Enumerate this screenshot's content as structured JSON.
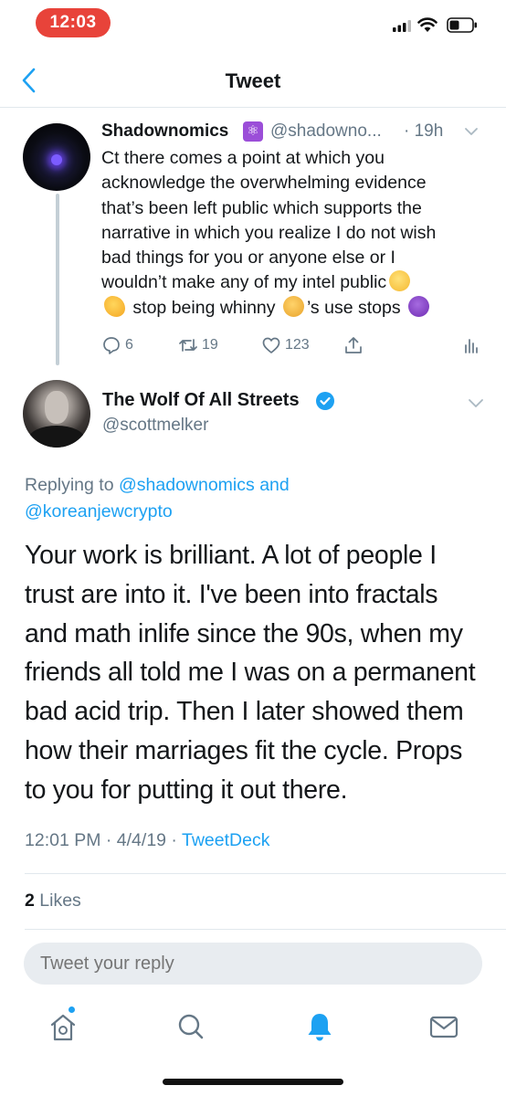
{
  "status_bar": {
    "time": "12:03"
  },
  "nav": {
    "title": "Tweet"
  },
  "parent_tweet": {
    "name": "Shadownomics",
    "handle": "@shadowno...",
    "time": "· 19h",
    "lines": [
      "Ct there comes a point at which you",
      "acknowledge the overwhelming evidence",
      "that’s been left public which supports the",
      "narrative in which you realize I do not wish",
      "bad things for you or anyone else or I",
      "wouldn’t make any of my intel public"
    ],
    "line7_a": "stop being whinny",
    "line7_b": "’s use stops",
    "actions": {
      "replies": "6",
      "retweets": "19",
      "likes": "123"
    },
    "colors": {
      "badge": "#9b4ed8"
    }
  },
  "main_tweet": {
    "name": "The Wolf Of All Streets",
    "handle": "@scottmelker",
    "replying_prefix": "Replying to",
    "replying_user1": "@shadownomics",
    "replying_and": "and",
    "replying_user2": "@koreanjewcrypto",
    "body_lines": [
      "Your work is brilliant. A lot of people I",
      "trust are into it. I've been into fractals",
      "and math inlife since the 90s, when my",
      "friends all told me I was on a permanent",
      "bad acid trip. Then I later showed them",
      "how their marriages fit the cycle. Props",
      "to you for putting it  out there."
    ],
    "timestamp": "12:01 PM · 4/4/19 ·",
    "source": "TweetDeck",
    "likes_count": "2",
    "likes_label": "Likes"
  },
  "reply_bar": {
    "placeholder": "Tweet your reply"
  },
  "tab_bar": {
    "items": [
      "home-icon",
      "search-icon",
      "notifications-icon",
      "messages-icon"
    ],
    "active": "notifications-icon"
  },
  "colors": {
    "accent": "#1da1f2",
    "muted": "#657786",
    "text": "#14171a",
    "status_pill": "#e8433a"
  }
}
